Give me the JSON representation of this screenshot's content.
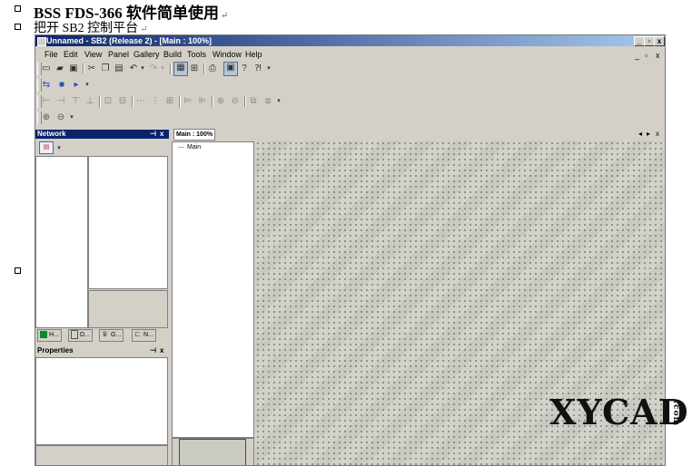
{
  "doc": {
    "heading": "BSS FDS-366 软件简单使用",
    "subheading": "把开 SB2 控制平台",
    "para_mark": "↵"
  },
  "window": {
    "title": "Unnamed - SB2 (Release 2) - [Main : 100%]",
    "controls": [
      "_",
      "▫",
      "x"
    ]
  },
  "menu": [
    "File",
    "Edit",
    "View",
    "Panel",
    "Gallery",
    "Build",
    "Tools",
    "Window",
    "Help"
  ],
  "mdi_controls": [
    "_",
    "▫",
    "x"
  ],
  "network_pane": {
    "title": "Network",
    "tabs": [
      "H...",
      "D...",
      "G...",
      "N..."
    ]
  },
  "properties_pane": {
    "title": "Properties"
  },
  "pane_buttons": {
    "pin": "⊣",
    "close": "x"
  },
  "document_tab": {
    "label": "Main : 100%"
  },
  "tree": {
    "root": "Main"
  },
  "tab_nav": [
    "◂",
    "▸",
    "x"
  ],
  "watermark": {
    "text": "XYCAD",
    "suffix": ".com"
  },
  "colors": {
    "titlebar": "#0a246a",
    "chrome": "#d4d0c8",
    "canvas": "#c9cbc2"
  }
}
